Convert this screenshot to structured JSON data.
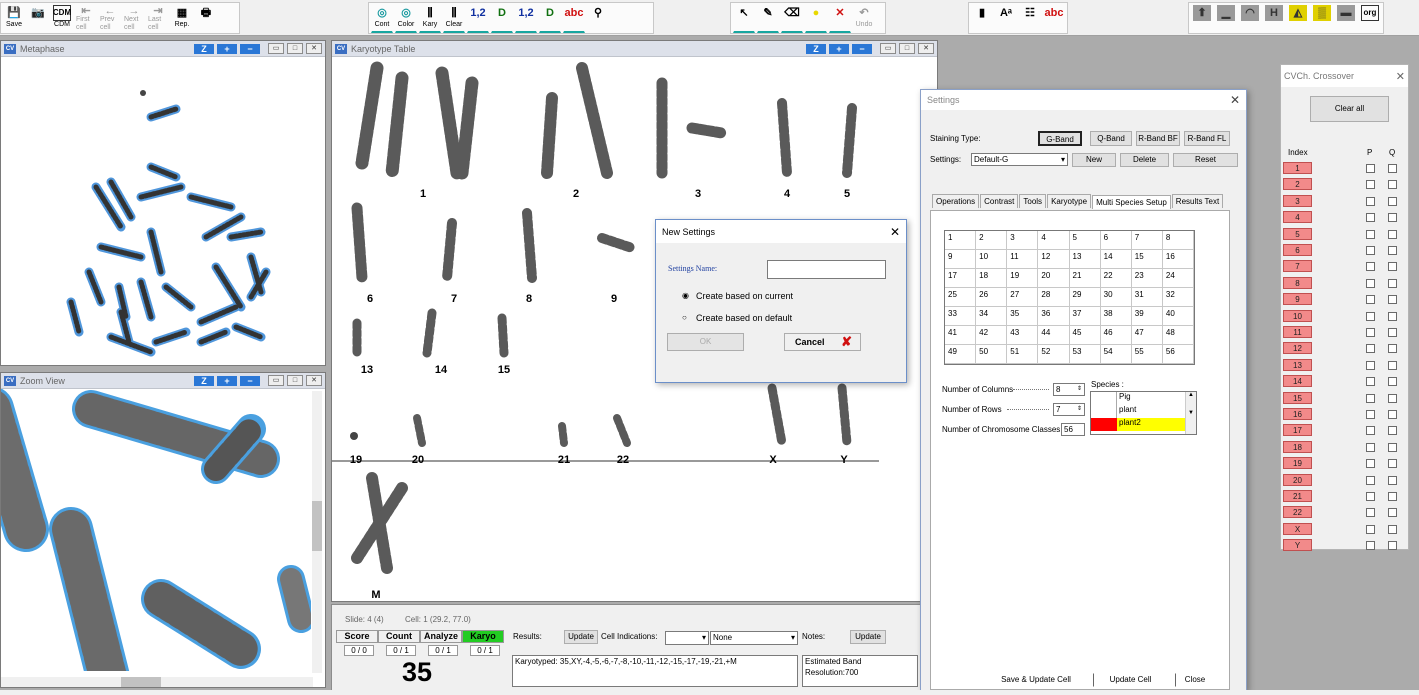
{
  "toolbar": {
    "group1": [
      {
        "name": "save",
        "label": "Save",
        "glyph": "💾"
      },
      {
        "name": "camera",
        "label": "",
        "glyph": "📷"
      },
      {
        "name": "cdm",
        "label": "CDM",
        "glyph": ""
      },
      {
        "name": "first-cell",
        "label": "First cell",
        "glyph": "⇤"
      },
      {
        "name": "prev-cell",
        "label": "Prev cell",
        "glyph": "←"
      },
      {
        "name": "next-cell",
        "label": "Next cell",
        "glyph": "→"
      },
      {
        "name": "last-cell",
        "label": "Last cell",
        "glyph": "⇥"
      },
      {
        "name": "rep",
        "label": "Rep.",
        "glyph": "▦"
      },
      {
        "name": "print",
        "label": "",
        "glyph": "🖶"
      }
    ],
    "group2": [
      {
        "name": "cont",
        "label": "Cont",
        "glyph": "◎"
      },
      {
        "name": "color",
        "label": "Color",
        "glyph": "◎"
      },
      {
        "name": "kary",
        "label": "Kary",
        "glyph": "⫼"
      },
      {
        "name": "clear",
        "label": "Clear",
        "glyph": "⫼"
      },
      {
        "name": "num12",
        "label": "",
        "glyph": "1,2"
      },
      {
        "name": "d-dots",
        "label": "",
        "glyph": "D"
      },
      {
        "name": "num12b",
        "label": "",
        "glyph": "1,2"
      },
      {
        "name": "d12",
        "label": "",
        "glyph": "D"
      },
      {
        "name": "abc",
        "label": "",
        "glyph": "abc"
      },
      {
        "name": "probe",
        "label": "",
        "glyph": "⚲"
      }
    ],
    "group3": [
      {
        "name": "pointer",
        "label": "",
        "glyph": "↖"
      },
      {
        "name": "pen",
        "label": "",
        "glyph": "✎"
      },
      {
        "name": "brush",
        "label": "",
        "glyph": "⌫"
      },
      {
        "name": "circle",
        "label": "",
        "glyph": "●"
      },
      {
        "name": "delete",
        "label": "",
        "glyph": "✕"
      },
      {
        "name": "undo",
        "label": "Undo",
        "glyph": "↶"
      }
    ],
    "group4": [
      {
        "name": "k1",
        "label": "",
        "glyph": "▮"
      },
      {
        "name": "k2",
        "label": "",
        "glyph": "Aᵃ"
      },
      {
        "name": "k3",
        "label": "",
        "glyph": "☷"
      },
      {
        "name": "k4",
        "label": "",
        "glyph": "abc"
      }
    ],
    "group5": [
      {
        "name": "i1",
        "label": "",
        "glyph": "⬆"
      },
      {
        "name": "i2",
        "label": "",
        "glyph": "▁"
      },
      {
        "name": "i3",
        "label": "",
        "glyph": "◠"
      },
      {
        "name": "i4",
        "label": "",
        "glyph": "H"
      },
      {
        "name": "i5",
        "label": "",
        "glyph": "◭"
      },
      {
        "name": "i6",
        "label": "",
        "glyph": "▒"
      },
      {
        "name": "i7",
        "label": "",
        "glyph": "▬"
      },
      {
        "name": "org",
        "label": "",
        "glyph": "org"
      }
    ]
  },
  "metaphase": {
    "title": "Metaphase"
  },
  "zoom": {
    "title": "Zoom View"
  },
  "karyotype": {
    "title": "Karyotype Table",
    "labels": [
      "1",
      "2",
      "3",
      "4",
      "5",
      "6",
      "7",
      "8",
      "9",
      "13",
      "14",
      "15",
      "19",
      "20",
      "21",
      "22",
      "X",
      "Y",
      "M"
    ]
  },
  "bottom": {
    "slide": "Slide: 4 (4)",
    "cell": "Cell: 1 (29.2, 77.0)",
    "tabs": [
      "Score",
      "Count",
      "Analyze",
      "Karyo"
    ],
    "counts": [
      "0 / 0",
      "0 / 1",
      "0 / 1",
      "0 / 1"
    ],
    "big_count": "35",
    "results_label": "Results:",
    "update_label": "Update",
    "cell_indications_label": "Cell Indications:",
    "none_label": "None",
    "notes_label": "Notes:",
    "notes_update": "Update",
    "results_text": "Karyotyped: 35,XY,-4,-5,-6,-7,-8,-10,-11,-12,-15,-17,-19,-21,+M",
    "notes_text": "Estimated Band Resolution:700"
  },
  "settings": {
    "title": "Settings",
    "staining_label": "Staining Type:",
    "staining": [
      "G-Band",
      "Q-Band",
      "R-Band BF",
      "R-Band FL"
    ],
    "settings_label": "Settings:",
    "settings_value": "Default-G",
    "new": "New",
    "delete": "Delete",
    "reset": "Reset",
    "tabs": [
      "Operations",
      "Contrast",
      "Tools",
      "Karyotype",
      "Multi Species Setup",
      "Results Text"
    ],
    "grid": [
      "1",
      "2",
      "3",
      "4",
      "5",
      "6",
      "7",
      "8",
      "9",
      "10",
      "11",
      "12",
      "13",
      "14",
      "15",
      "16",
      "17",
      "18",
      "19",
      "20",
      "21",
      "22",
      "23",
      "24",
      "25",
      "26",
      "27",
      "28",
      "29",
      "30",
      "31",
      "32",
      "33",
      "34",
      "35",
      "36",
      "37",
      "38",
      "39",
      "40",
      "41",
      "42",
      "43",
      "44",
      "45",
      "46",
      "47",
      "48",
      "49",
      "50",
      "51",
      "52",
      "53",
      "54",
      "55",
      "56"
    ],
    "columns_label": "Number of Columns",
    "columns": "8",
    "rows_label": "Number of Rows",
    "rows": "7",
    "classes_label": "Number of Chromosome Classes",
    "classes": "56",
    "species_label": "Species :",
    "species": [
      "Pig",
      "plant",
      "plant2"
    ],
    "save_update": "Save & Update Cell",
    "update_cell": "Update Cell",
    "close": "Close"
  },
  "new_settings": {
    "title": "New Settings",
    "name_label": "Settings Name:",
    "name_value": "",
    "opt1": "Create based on current",
    "opt2": "Create based on default",
    "ok": "OK",
    "cancel": "Cancel"
  },
  "crossover": {
    "title": "Ch. Crossover",
    "clear_all": "Clear all",
    "index_label": "Index",
    "p_label": "P",
    "q_label": "Q",
    "items": [
      "1",
      "2",
      "3",
      "4",
      "5",
      "6",
      "7",
      "8",
      "9",
      "10",
      "11",
      "12",
      "13",
      "14",
      "15",
      "16",
      "17",
      "18",
      "19",
      "20",
      "21",
      "22",
      "X",
      "Y"
    ]
  },
  "colors": {
    "accent": "#2a77d6",
    "index_bg": "#f28a8a",
    "karyo_tab": "#22cc22",
    "species_sel": "#ffff00",
    "species_red": "#ff0000"
  }
}
